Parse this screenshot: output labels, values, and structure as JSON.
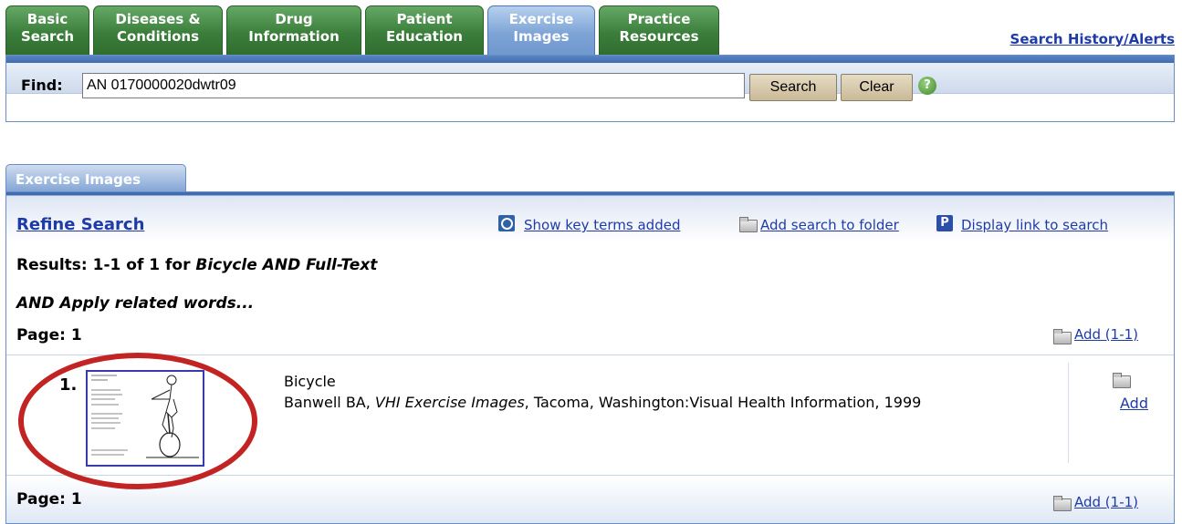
{
  "tabs": [
    {
      "line1": "Basic",
      "line2": "Search"
    },
    {
      "line1": "Diseases &",
      "line2": "Conditions"
    },
    {
      "line1": "Drug",
      "line2": "Information"
    },
    {
      "line1": "Patient",
      "line2": "Education"
    },
    {
      "line1": "Exercise",
      "line2": "Images"
    },
    {
      "line1": "Practice",
      "line2": "Resources"
    }
  ],
  "active_tab": "Exercise Images",
  "history_link": "Search History/Alerts",
  "find": {
    "label": "Find:",
    "value": "AN 0170000020dwtr09",
    "search_button": "Search",
    "clear_button": "Clear",
    "help_icon": "?"
  },
  "section_tab": "Exercise Images",
  "toolbar": {
    "refine": "Refine Search",
    "show_terms": "Show key terms added",
    "add_folder": "Add search to folder",
    "display_link": "Display link to search",
    "p_icon": "P"
  },
  "results": {
    "summary": "Results: 1-1 of 1 for ",
    "query": "Bicycle AND Full-Text",
    "apply": "AND Apply related words...",
    "page_top": "Page: 1",
    "page_bottom": "Page: 1",
    "add_range_top": "Add (1-1)",
    "add_range_bottom": "Add (1-1)"
  },
  "result": {
    "number": "1.",
    "title": "Bicycle",
    "citation_author": "Banwell BA, ",
    "citation_source": "VHI Exercise Images",
    "citation_rest": ", Tacoma, Washington:Visual Health Information, 1999",
    "add": "Add"
  },
  "colors": {
    "tab_green": "#3b7d3b",
    "tab_active_blue": "#7ea4d6",
    "link_blue": "#1f3ba8",
    "highlight_circle": "#c22424"
  }
}
